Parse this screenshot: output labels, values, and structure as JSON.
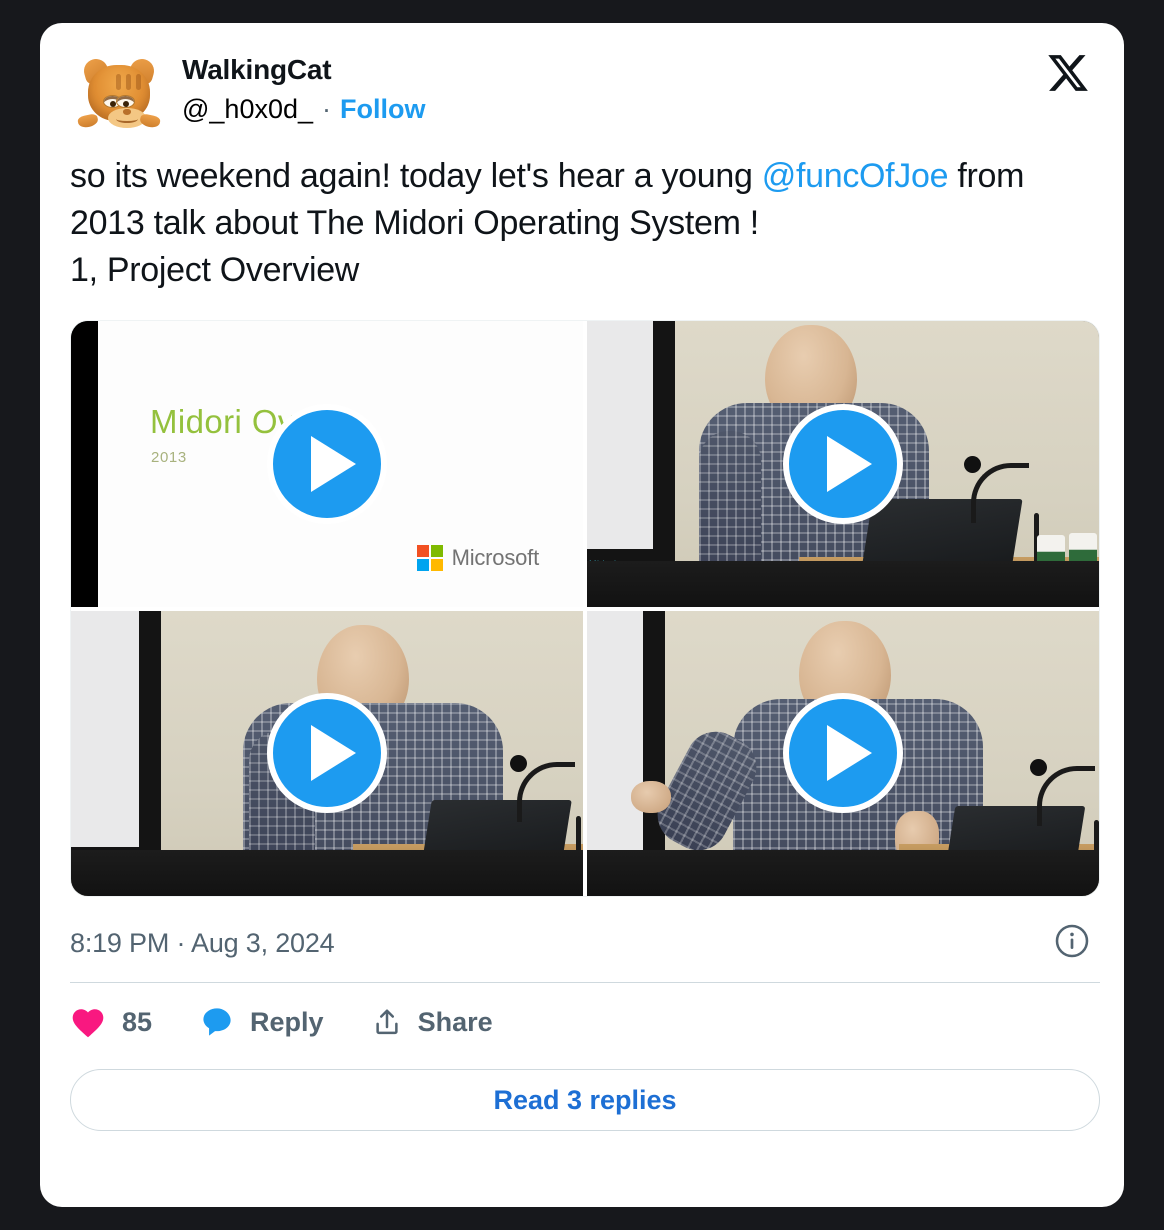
{
  "theme": {
    "page_bg": "#17181c",
    "card_bg": "#ffffff",
    "link_blue": "#1d9bf0",
    "like_pink": "#f91880",
    "muted_text": "#536471",
    "replies_blue": "#1d6fd4"
  },
  "header": {
    "display_name": "WalkingCat",
    "handle": "@_h0x0d_",
    "separator": "·",
    "follow_label": "Follow",
    "avatar_alt": "garfield-cat-avatar",
    "brand_icon": "x-logo"
  },
  "tweet": {
    "line1": "so its weekend again! today let's hear a young ",
    "mention": "@funcOfJoe",
    "line2": " from 2013 talk about The Midori Operating System !",
    "line3": "1, Project Overview"
  },
  "media": {
    "play_icon": "play-icon",
    "tiles": [
      {
        "name": "midori-overview-slide",
        "slide_title": "Midori Ove",
        "slide_year": "2013",
        "brand": "Microsoft"
      },
      {
        "name": "lecture-video-2"
      },
      {
        "name": "lecture-video-3"
      },
      {
        "name": "lecture-video-4"
      }
    ],
    "projector_label": "Midori"
  },
  "meta": {
    "timestamp": "8:19 PM · Aug 3, 2024",
    "info_icon": "info-circle-icon"
  },
  "actions": {
    "like": {
      "icon": "heart-icon",
      "count": "85"
    },
    "reply": {
      "icon": "reply-bubble-icon",
      "label": "Reply"
    },
    "share": {
      "icon": "share-arrow-icon",
      "label": "Share"
    }
  },
  "footer": {
    "read_replies_label": "Read 3 replies"
  }
}
